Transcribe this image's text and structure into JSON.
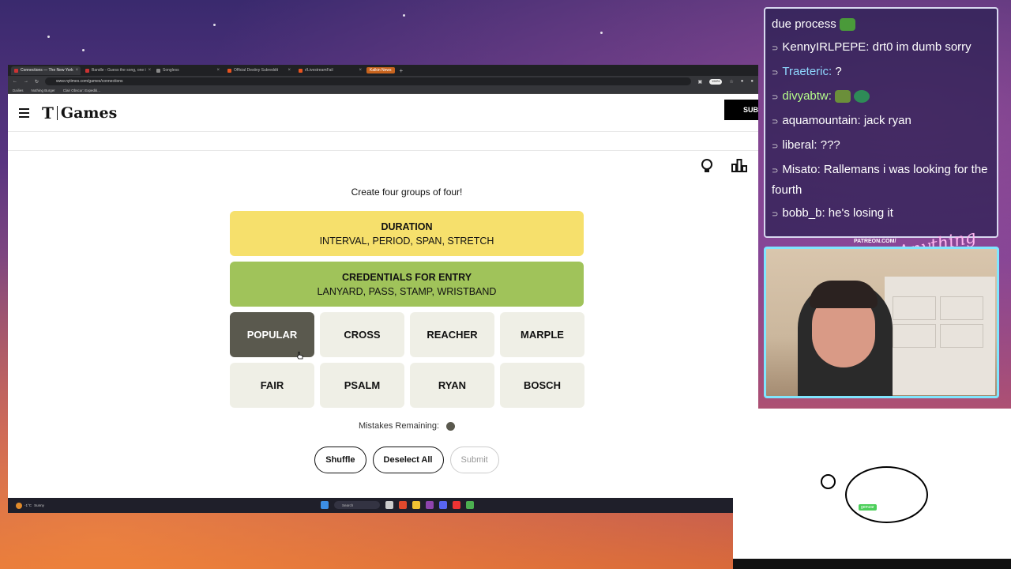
{
  "browser": {
    "tabs": [
      {
        "label": "Connections — The New York",
        "active": true
      },
      {
        "label": "Bandle - Guess the song, one i",
        "active": false
      },
      {
        "label": "Songless",
        "active": false
      },
      {
        "label": "Official Destiny Subreddit",
        "active": false
      },
      {
        "label": "r/LivestreamFail",
        "active": false
      }
    ],
    "badge_tab": "Kalkin News",
    "url": "www.nytimes.com/games/connections",
    "zoom": "150%",
    "bookmarks": [
      "Dailies",
      "Nothing Burger",
      "Clair Obscur: Expediti..."
    ]
  },
  "site": {
    "logo_mark": "T",
    "logo_text": "Games",
    "subscribe_label": "SUBS"
  },
  "game": {
    "instruction": "Create four groups of four!",
    "solved_groups": [
      {
        "title": "DURATION",
        "words": "INTERVAL, PERIOD, SPAN, STRETCH",
        "color": "#f6e06c"
      },
      {
        "title": "CREDENTIALS FOR ENTRY",
        "words": "LANYARD, PASS, STAMP, WRISTBAND",
        "color": "#a0c35a"
      }
    ],
    "cards": [
      {
        "word": "POPULAR",
        "selected": true
      },
      {
        "word": "CROSS",
        "selected": false
      },
      {
        "word": "REACHER",
        "selected": false
      },
      {
        "word": "MARPLE",
        "selected": false
      },
      {
        "word": "FAIR",
        "selected": false
      },
      {
        "word": "PSALM",
        "selected": false
      },
      {
        "word": "RYAN",
        "selected": false
      },
      {
        "word": "BOSCH",
        "selected": false
      }
    ],
    "mistakes_label": "Mistakes Remaining:",
    "mistakes_remaining": 1,
    "buttons": {
      "shuffle": "Shuffle",
      "deselect": "Deselect All",
      "submit": "Submit"
    }
  },
  "taskbar": {
    "weather_temp": "-1°C",
    "weather_desc": "Sunny",
    "search_placeholder": "Search"
  },
  "chat": {
    "messages": [
      {
        "user": "",
        "text": "due process",
        "color": "#ffffff",
        "emote": true
      },
      {
        "user": "KennyIRLPEPE:",
        "text": "drt0 im dumb sorry",
        "color": "#ffffff"
      },
      {
        "user": "Traeteric:",
        "text": "?",
        "color": "#8fd8ff"
      },
      {
        "user": "divyabtw:",
        "text": "",
        "color": "#b6ff8a",
        "emote": true
      },
      {
        "user": "aquamountain:",
        "text": "jack ryan",
        "color": "#ffffff"
      },
      {
        "user": "liberal:",
        "text": "???",
        "color": "#ffffff"
      },
      {
        "user": "Misato:",
        "text": "Rallemans i was looking for the fourth",
        "color": "#ffffff"
      },
      {
        "user": "bobb_b:",
        "text": "he's losing it",
        "color": "#ffffff"
      }
    ]
  },
  "overlay": {
    "patreon_label": "PATREON.COM/",
    "brand_text": "Anything Else",
    "blob_tag": "gemzar"
  }
}
